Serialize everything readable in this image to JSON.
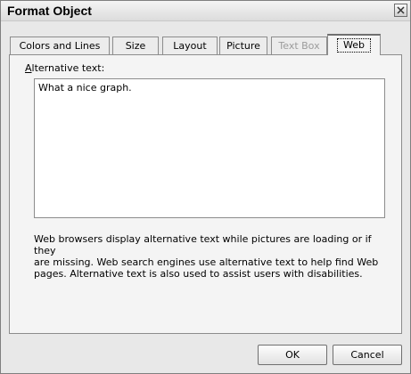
{
  "window": {
    "title": "Format Object"
  },
  "tabs": [
    {
      "label": "Colors and Lines",
      "state": "normal"
    },
    {
      "label": "Size",
      "state": "normal"
    },
    {
      "label": "Layout",
      "state": "normal"
    },
    {
      "label": "Picture",
      "state": "normal"
    },
    {
      "label": "Text Box",
      "state": "disabled"
    },
    {
      "label": "Web",
      "state": "active"
    }
  ],
  "web_tab": {
    "alt_label_accel": "A",
    "alt_label_rest": "lternative text:",
    "alt_text_value": "What a nice graph.",
    "help_lines": [
      "Web browsers display alternative text while pictures are loading or if they",
      "are missing.  Web search engines use alternative text to help find Web",
      "pages.  Alternative text is also used to assist users with disabilities."
    ]
  },
  "buttons": {
    "ok": "OK",
    "cancel": "Cancel"
  },
  "icons": {
    "close": "close-icon"
  }
}
